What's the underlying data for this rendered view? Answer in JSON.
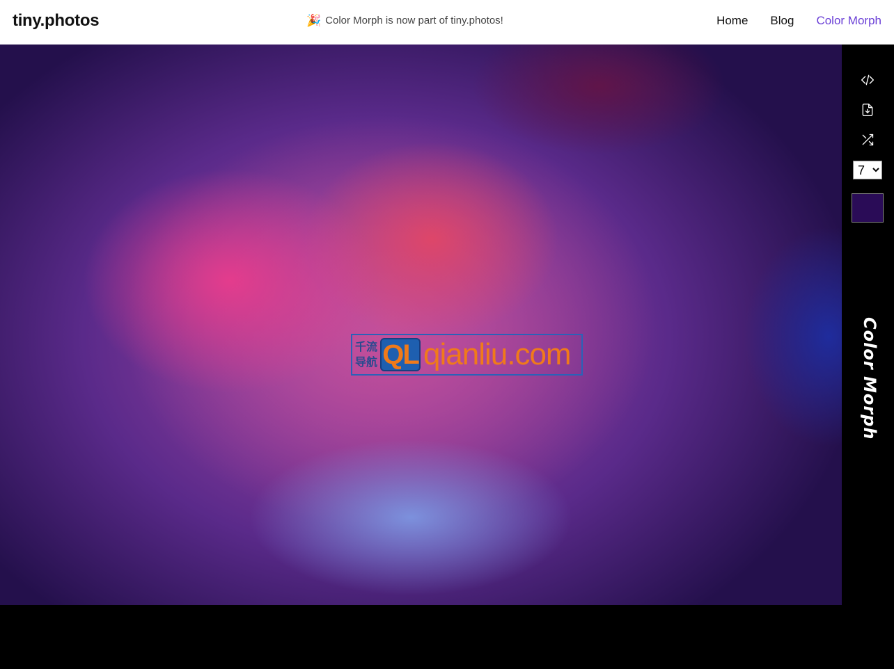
{
  "header": {
    "logo": "tiny.photos",
    "announcement_emoji": "🎉",
    "announcement": "Color Morph is now part of tiny.photos!",
    "nav": [
      {
        "label": "Home"
      },
      {
        "label": "Blog"
      },
      {
        "label": "Color Morph"
      }
    ],
    "active_color": "#6a3fd6"
  },
  "watermark": {
    "cn_line1": "千流",
    "cn_line2": "导航",
    "badge": "QL",
    "domain": "qianliu.com"
  },
  "sidebar": {
    "icons": [
      "code-icon",
      "file-download-icon",
      "shuffle-icon"
    ],
    "count_value": "7",
    "count_options": [
      "7"
    ],
    "swatch_color": "#2a0c57",
    "vertical_title": "Color Morph"
  }
}
